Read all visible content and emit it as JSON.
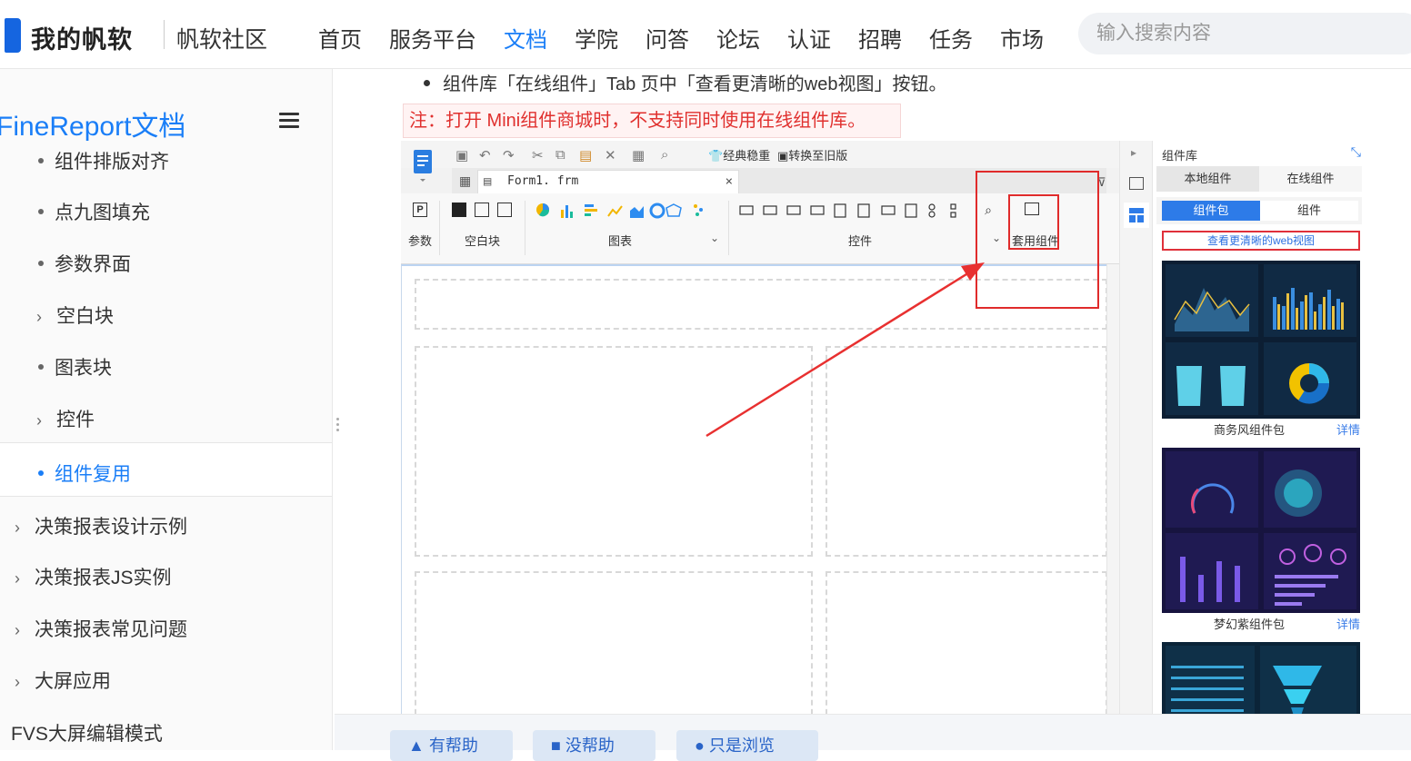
{
  "header": {
    "logo": "我的帆软",
    "community": "帆软社区",
    "nav": [
      "首页",
      "服务平台",
      "文档",
      "学院",
      "问答",
      "论坛",
      "认证",
      "招聘",
      "任务",
      "市场"
    ],
    "active_nav": "文档",
    "search_placeholder": "输入搜索内容"
  },
  "sidebar": {
    "title": "FineReport文档",
    "items": [
      {
        "label": "组件排版对齐",
        "marker": "dot"
      },
      {
        "label": "点九图填充",
        "marker": "dot"
      },
      {
        "label": "参数界面",
        "marker": "dot"
      },
      {
        "label": "空白块",
        "marker": "chevron"
      },
      {
        "label": "图表块",
        "marker": "dot"
      },
      {
        "label": "控件",
        "marker": "chevron"
      },
      {
        "label": "组件复用",
        "marker": "dot",
        "active": true
      },
      {
        "label": "决策报表设计示例",
        "marker": "chevron"
      },
      {
        "label": "决策报表JS实例",
        "marker": "chevron"
      },
      {
        "label": "决策报表常见问题",
        "marker": "chevron"
      },
      {
        "label": "大屏应用",
        "marker": "chevron"
      },
      {
        "label": "FVS大屏编辑模式",
        "marker": "none"
      }
    ]
  },
  "content": {
    "bullet": "组件库「在线组件」Tab 页中「查看更清晰的web视图」按钮。",
    "note": "注：打开 Mini组件商城时，不支持同时使用在线组件库。"
  },
  "designer": {
    "toolbar": {
      "classic": "经典稳重",
      "convert": "转换至旧版"
    },
    "tab_file": "Form1. frm",
    "ribbon": {
      "param": "参数",
      "blank": "空白块",
      "chart": "图表",
      "widget": "控件",
      "reuse": "套用组件"
    },
    "library": {
      "title": "组件库",
      "tabs": [
        "本地组件",
        "在线组件"
      ],
      "subtabs": [
        "组件包",
        "组件"
      ],
      "webview": "查看更清晰的web视图",
      "packages": [
        {
          "name": "商务风组件包",
          "link": "详情"
        },
        {
          "name": "梦幻紫组件包",
          "link": "详情"
        }
      ]
    }
  },
  "footer": {
    "buttons": [
      "有帮助",
      "没帮助",
      "只是浏览"
    ]
  },
  "colors": {
    "accent": "#1a7ef7",
    "note_red": "#e0302e",
    "highlight": "#e02b2b"
  }
}
